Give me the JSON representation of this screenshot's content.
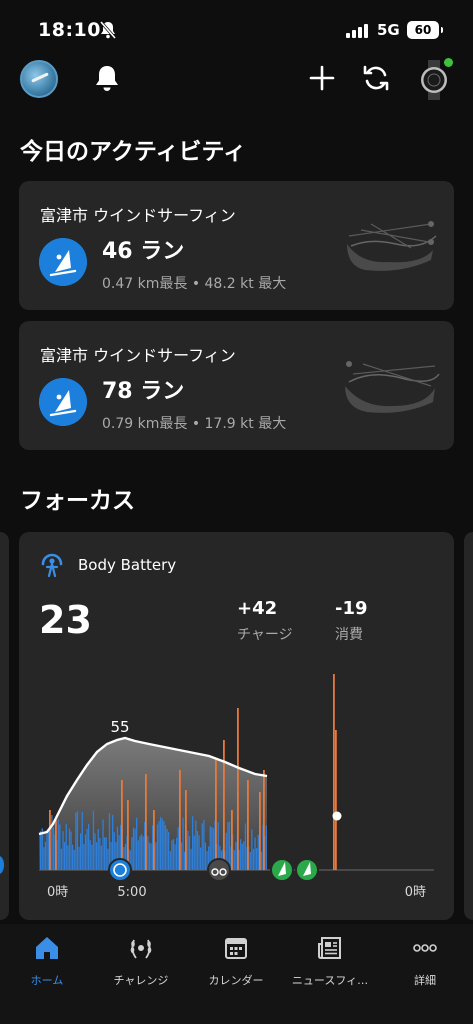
{
  "status_bar": {
    "time": "18:10",
    "network": "5G",
    "battery": "60"
  },
  "sections": {
    "today_activity": "今日のアクティビティ",
    "focus": "フォーカス"
  },
  "activities": [
    {
      "place": "富津市 ウインドサーフィン",
      "runs": "46 ラン",
      "detail": "0.47 km最長 • 48.2 kt 最大"
    },
    {
      "place": "富津市 ウインドサーフィン",
      "runs": "78 ラン",
      "detail": "0.79 km最長 • 17.9 kt 最大"
    }
  ],
  "body_battery": {
    "title": "Body Battery",
    "current": "23",
    "charge": "+42",
    "charge_label": "チャージ",
    "drain": "-19",
    "drain_label": "消費",
    "peak_label": "55",
    "x_labels": [
      "0時",
      "5:00",
      "0時"
    ]
  },
  "tabs": [
    {
      "label": "ホーム",
      "icon": "home-icon"
    },
    {
      "label": "チャレンジ",
      "icon": "laurel-icon"
    },
    {
      "label": "カレンダー",
      "icon": "calendar-icon"
    },
    {
      "label": "ニュースフィ…",
      "icon": "newspaper-icon"
    },
    {
      "label": "詳細",
      "icon": "more-icon"
    }
  ],
  "colors": {
    "accent": "#1d7fdc",
    "tab_active": "#3a8ee6",
    "stress": "#e8793a",
    "rest": "#2f7fd8",
    "sync_green": "#2aa84a"
  }
}
